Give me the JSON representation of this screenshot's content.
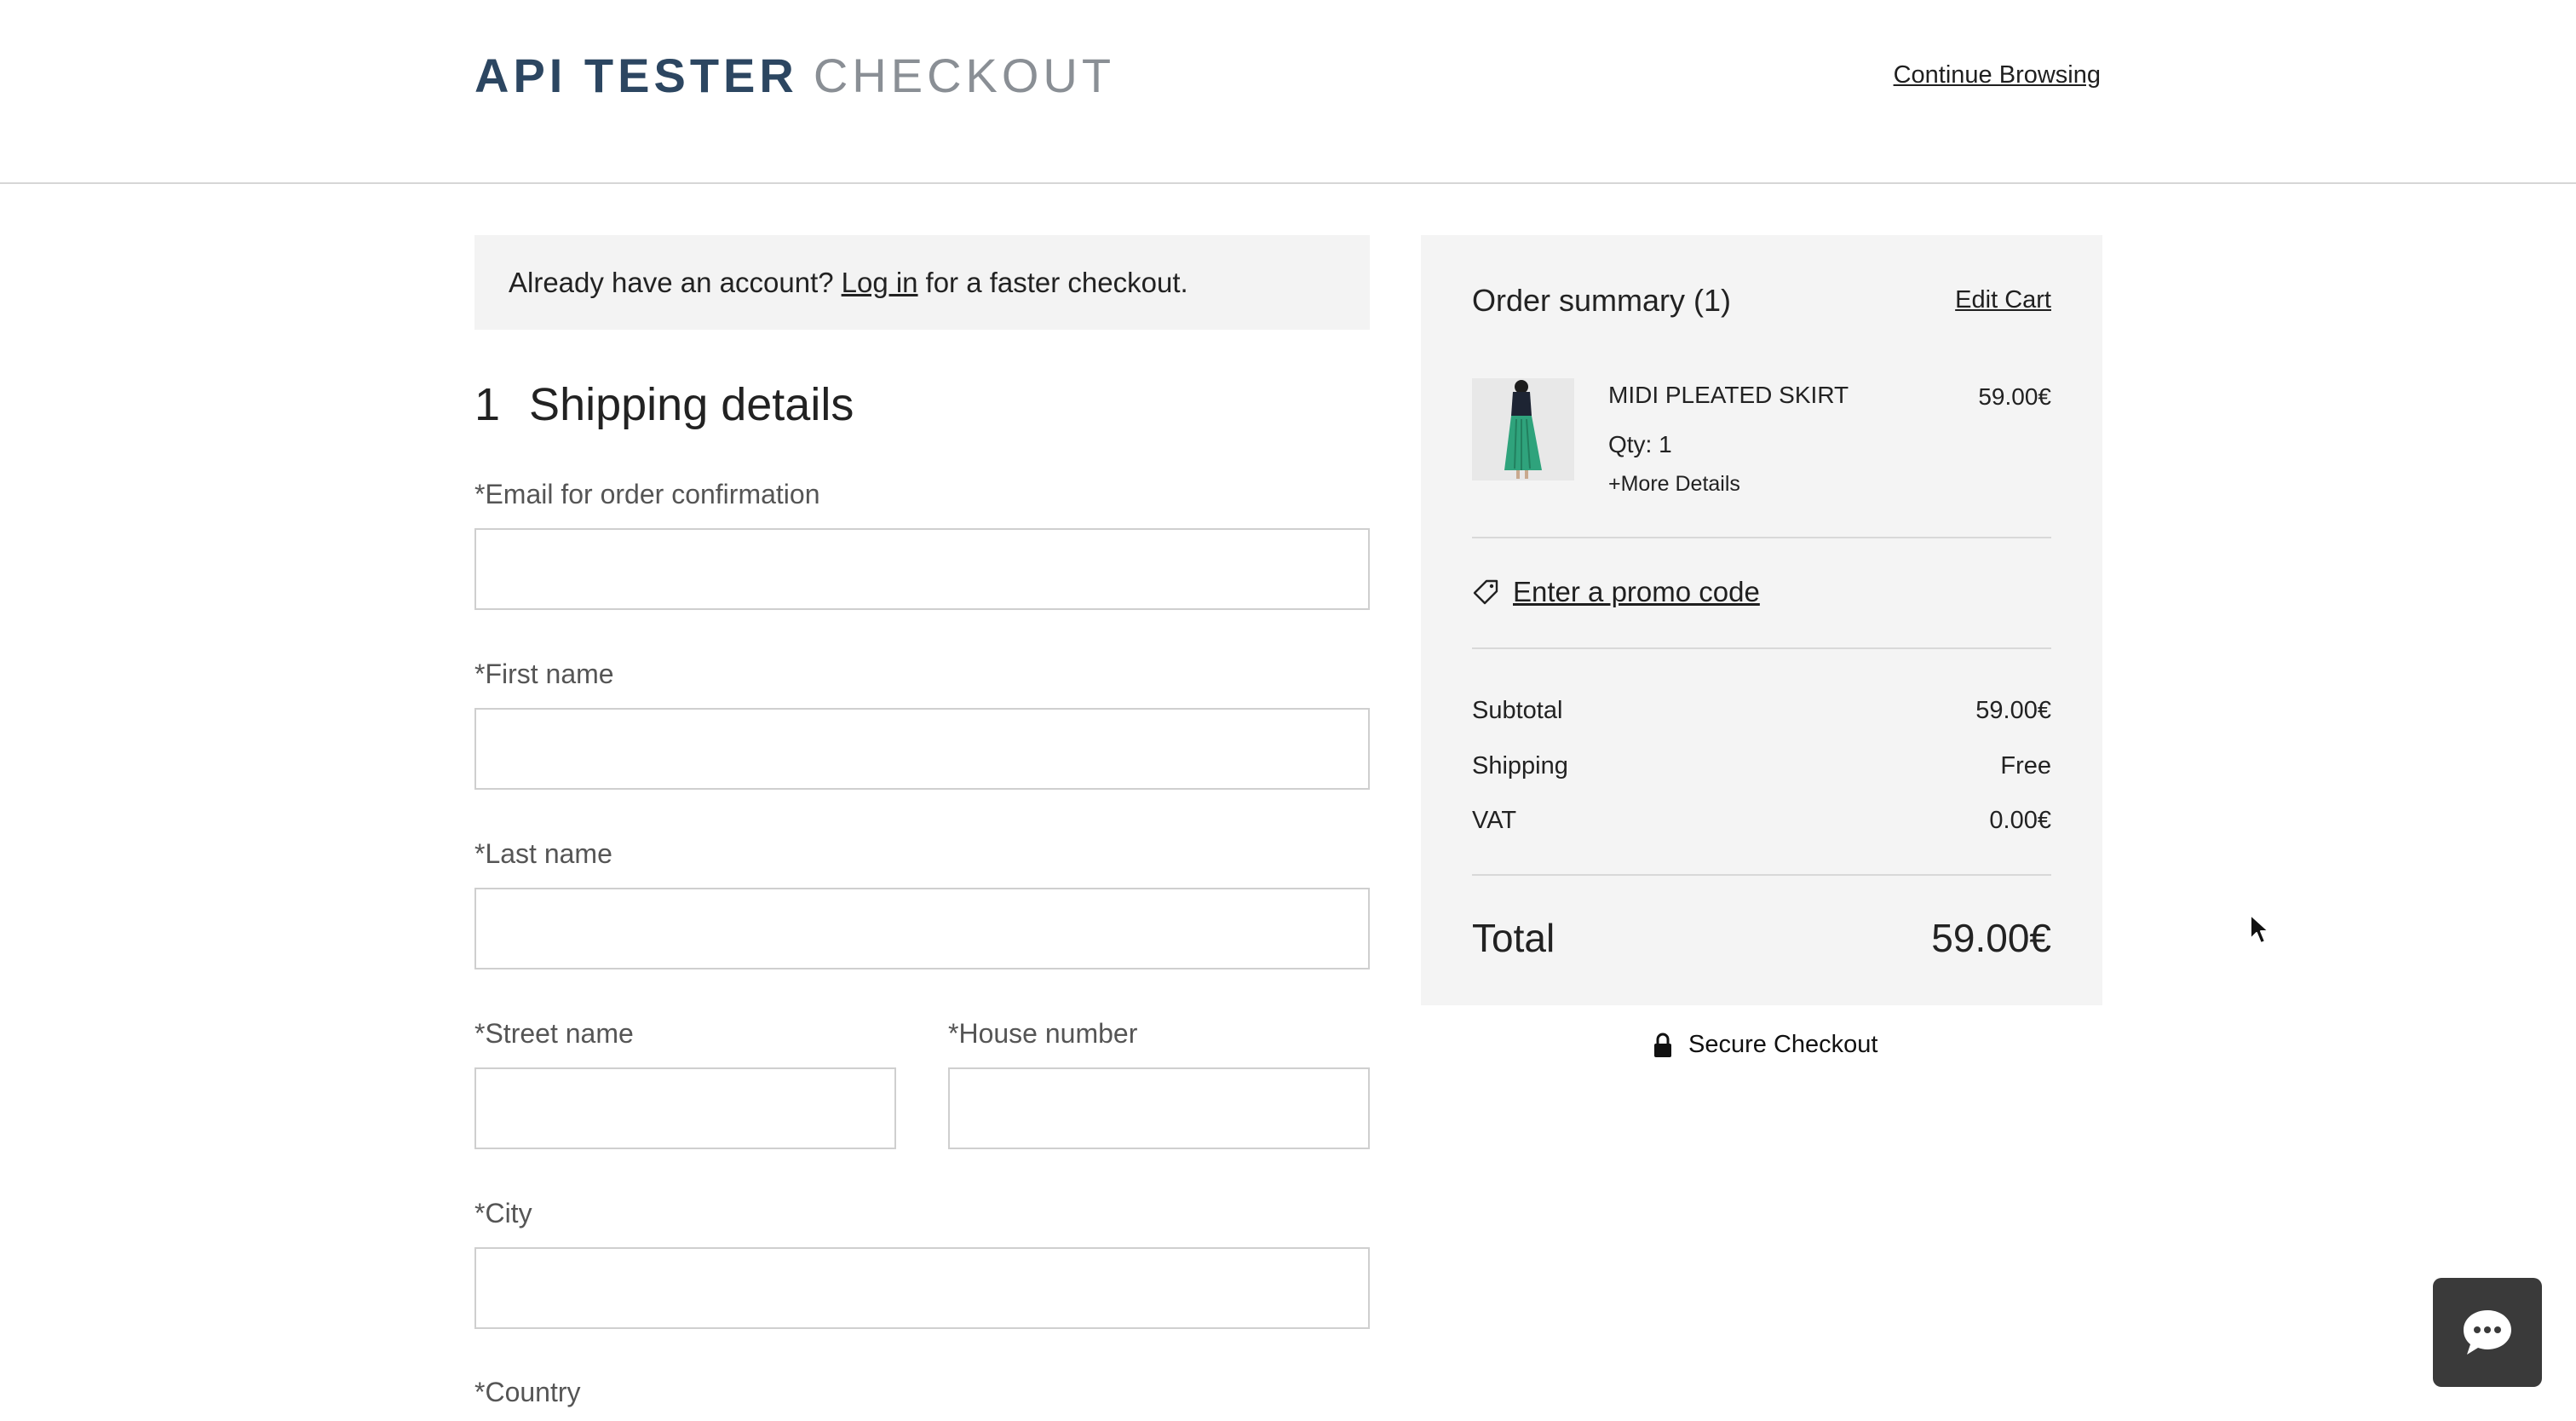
{
  "header": {
    "brand_primary": "API TESTER",
    "brand_secondary": "CHECKOUT",
    "continue_label": "Continue Browsing"
  },
  "login_bar": {
    "prefix": "Already have an account?",
    "link": "Log in",
    "suffix": "for a faster checkout."
  },
  "shipping": {
    "step_number": "1",
    "title": "Shipping details",
    "fields": {
      "email": {
        "label": "*Email for order confirmation",
        "value": ""
      },
      "first_name": {
        "label": "*First name",
        "value": ""
      },
      "last_name": {
        "label": "*Last name",
        "value": ""
      },
      "street": {
        "label": "*Street name",
        "value": ""
      },
      "house_number": {
        "label": "*House number",
        "value": ""
      },
      "city": {
        "label": "*City",
        "value": ""
      },
      "country": {
        "label": "*Country"
      }
    }
  },
  "summary": {
    "title": "Order summary (1)",
    "edit_cart": "Edit Cart",
    "item": {
      "name": "MIDI PLEATED SKIRT",
      "price": "59.00€",
      "qty": "Qty: 1",
      "more": "+More Details",
      "skirt_color": "#2fa37c"
    },
    "promo": "Enter a promo code",
    "rows": {
      "subtotal": {
        "label": "Subtotal",
        "value": "59.00€"
      },
      "shipping": {
        "label": "Shipping",
        "value": "Free"
      },
      "vat": {
        "label": "VAT",
        "value": "0.00€"
      }
    },
    "total": {
      "label": "Total",
      "value": "59.00€"
    }
  },
  "secure_checkout": "Secure Checkout",
  "icons": {
    "tag": "promo-tag-icon",
    "lock": "lock-icon",
    "chat": "chat-bubble-icon",
    "cursor": "mouse-cursor-icon"
  },
  "colors": {
    "brand": "#2c4661",
    "brand_muted": "#8a8f95",
    "panel_bg": "#f4f4f4",
    "chat_bg": "#3a3a3a"
  }
}
